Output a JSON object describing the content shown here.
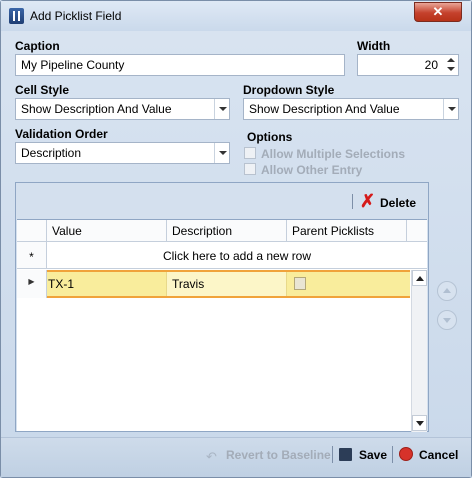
{
  "window": {
    "title": "Add Picklist Field",
    "close_icon": "✕"
  },
  "caption": {
    "label": "Caption",
    "value": "My Pipeline County"
  },
  "width": {
    "label": "Width",
    "value": "20"
  },
  "cell_style": {
    "label": "Cell Style",
    "value": "Show Description And Value"
  },
  "dropdown_style": {
    "label": "Dropdown Style",
    "value": "Show Description And Value"
  },
  "validation_order": {
    "label": "Validation Order",
    "value": "Description"
  },
  "options": {
    "label": "Options",
    "allow_multiple": "Allow Multiple Selections",
    "allow_other": "Allow Other Entry"
  },
  "toolbar": {
    "delete_label": "Delete",
    "delete_icon": "✗"
  },
  "grid": {
    "columns": [
      "Value",
      "Description",
      "Parent Picklists"
    ],
    "new_row_marker": "*",
    "new_row_text": "Click here to add a new row",
    "row_marker": "▶",
    "rows": [
      {
        "value": "TX-1",
        "description": "Travis"
      }
    ]
  },
  "footer": {
    "revert_label": "Revert to Baseline",
    "save_label": "Save",
    "cancel_label": "Cancel"
  },
  "colors": {
    "selected_row": "#f9ed9c",
    "selected_border": "#f0a33b",
    "accent": "#d51a1a"
  }
}
